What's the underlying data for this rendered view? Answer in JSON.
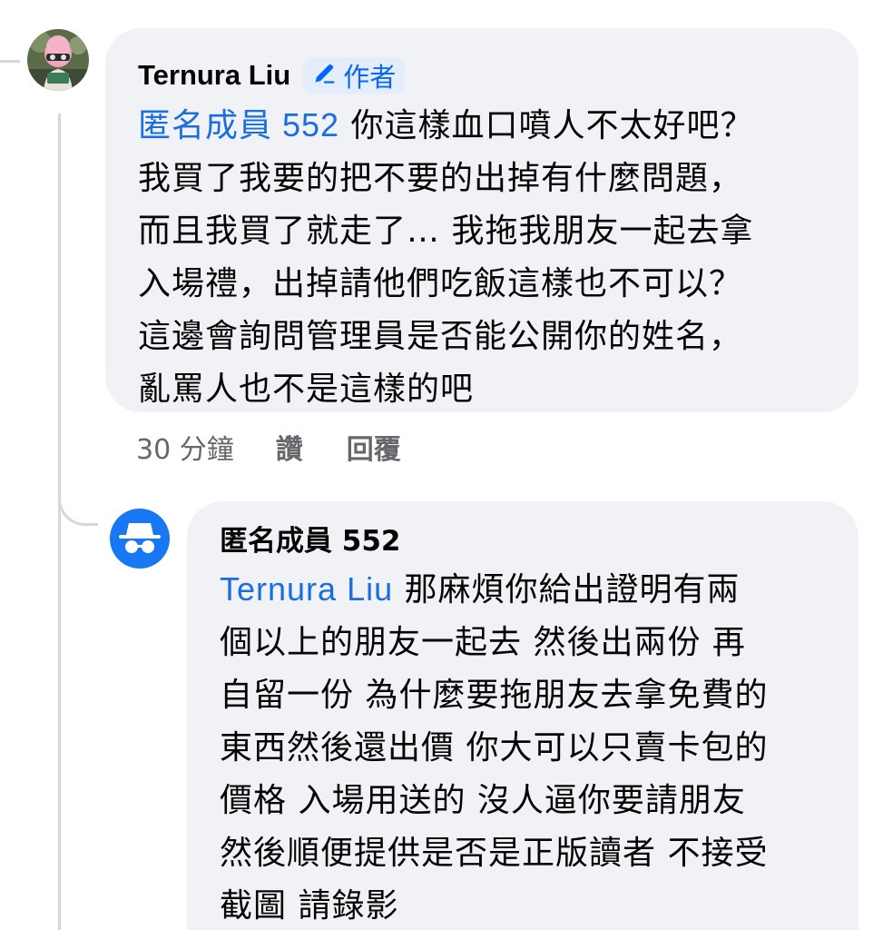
{
  "comment": {
    "author": "Ternura Liu",
    "author_badge": "作者",
    "mention": "匿名成員 552",
    "text_line_1": " 你這樣血口噴人不太好吧？",
    "text_rest": "我買了我要的把不要的出掉有什麼問題，\n而且我買了就走了… 我拖我朋友一起去拿\n入場禮，出掉請他們吃飯這樣也不可以？\n這邊會詢問管理員是否能公開你的姓名，\n亂罵人也不是這樣的吧",
    "timestamp": "30 分鐘",
    "like_label": "讚",
    "reply_label": "回覆"
  },
  "reply": {
    "author": "匿名成員 552",
    "mention": "Ternura Liu",
    "text_line_1": " 那麻煩你給出證明有兩",
    "text_rest": "個以上的朋友一起去 然後出兩份 再\n自留一份 為什麼要拖朋友去拿免費的\n東西然後還出價 你大可以只賣卡包的\n價格 入場用送的 沒人逼你要請朋友\n然後順便提供是否是正版讀者 不接受\n截圖 請錄影"
  },
  "icons": {
    "badge_icon": "pencil-icon",
    "anon_avatar_icon": "incognito-icon"
  },
  "colors": {
    "mention": "#1a6ee0",
    "bubble": "#f0f2f5",
    "badge_bg": "#e4edfb",
    "badge_text": "#0866ff",
    "anon_avatar": "#1877f2",
    "meta_text": "#65676b"
  }
}
